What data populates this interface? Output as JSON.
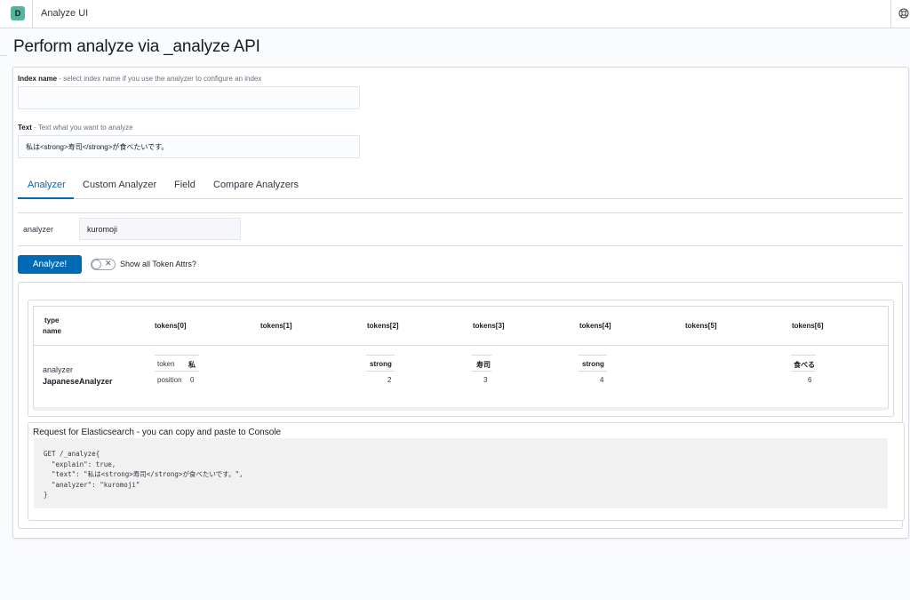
{
  "header": {
    "app_badge": "D",
    "app_title": "Analyze UI",
    "help_icon": "help-icon"
  },
  "page": {
    "title": "Perform analyze via _analyze API"
  },
  "form": {
    "index_name": {
      "label": "Index name",
      "hint": " - select index name if you use the analyzer to configure an index",
      "value": ""
    },
    "text": {
      "label": "Text",
      "hint": " - Text what you want to analyze",
      "value": "私は<strong>寿司</strong>が食べたいです。"
    }
  },
  "tabs": [
    {
      "label": "Analyzer",
      "selected": true
    },
    {
      "label": "Custom Analyzer",
      "selected": false
    },
    {
      "label": "Field",
      "selected": false
    },
    {
      "label": "Compare Analyzers",
      "selected": false
    }
  ],
  "analyzer_field": {
    "label": "analyzer",
    "value": "kuromoji"
  },
  "actions": {
    "analyze_label": "Analyze!",
    "toggle_label": "Show all Token Attrs?",
    "toggle_on": false
  },
  "result_table": {
    "header_type": "type",
    "header_name": "name",
    "columns": [
      "tokens[0]",
      "tokens[1]",
      "tokens[2]",
      "tokens[3]",
      "tokens[4]",
      "tokens[5]",
      "tokens[6]"
    ],
    "row": {
      "type": "analyzer",
      "name": "JapaneseAnalyzer",
      "token_key": "token",
      "position_key": "position",
      "tokens": [
        {
          "token": "私",
          "position": "0"
        },
        {
          "token": "",
          "position": ""
        },
        {
          "token": "strong",
          "position": "2"
        },
        {
          "token": "寿司",
          "position": "3"
        },
        {
          "token": "strong",
          "position": "4"
        },
        {
          "token": "",
          "position": ""
        },
        {
          "token": "食べる",
          "position": "6"
        }
      ]
    }
  },
  "request": {
    "title": "Request for Elasticsearch - you can copy and paste to Console",
    "code": "GET /_analyze{\n  \"explain\": true,\n  \"text\": \"私は<strong>寿司</strong>が食べたいです。\",\n  \"analyzer\": \"kuromoji\"\n}"
  },
  "colors": {
    "accent": "#006bb4",
    "badge": "#54b399",
    "border": "#d3dae6"
  }
}
